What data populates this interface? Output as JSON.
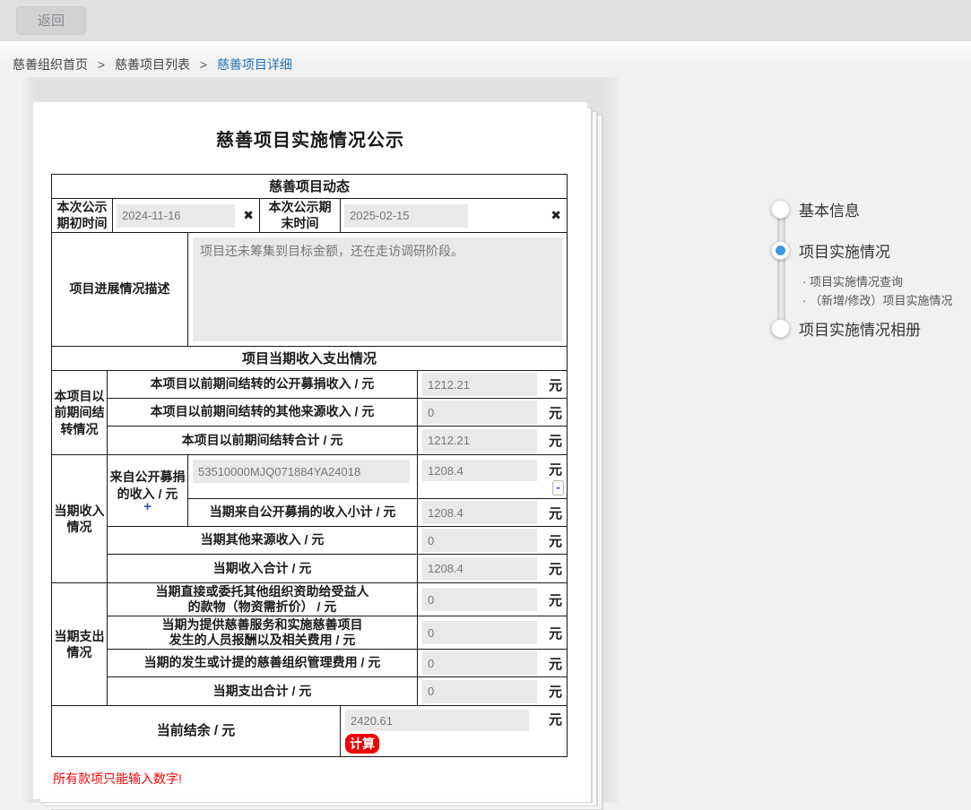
{
  "topbar": {
    "back_button": "返回"
  },
  "breadcrumb": {
    "separator": ">",
    "items": [
      "慈善组织首页",
      "慈善项目列表",
      "慈善项目详细"
    ]
  },
  "page": {
    "title": "慈善项目实施情况公示",
    "error_note": "所有款项只能输入数字!"
  },
  "dynamics": {
    "section_title": "慈善项目动态",
    "start_label": "本次公示期初时间",
    "start_value": "2024-11-16",
    "end_label": "本次公示期末时间",
    "end_value": "2025-02-15",
    "clear_icon": "✖",
    "desc_label": "项目进展情况描述",
    "desc_value": "项目还未筹集到目标金额，还在走访调研阶段。"
  },
  "finance": {
    "section_title": "项目当期收入支出情况",
    "unit": "元",
    "carryover": {
      "group_label": "本项目以前期间结转情况",
      "rows": [
        {
          "label": "本项目以前期间结转的公开募捐收入 / 元",
          "value": "1212.21"
        },
        {
          "label": "本项目以前期间结转的其他来源收入 / 元",
          "value": "0"
        },
        {
          "label": "本项目以前期间结转合计 / 元",
          "value": "1212.21"
        }
      ]
    },
    "income": {
      "group_label": "当期收入情况",
      "public_label": "来自公开募捐的收入 / 元",
      "add_icon": "+",
      "remove_icon": "-",
      "public_id": "53510000MJQ071884YA24018",
      "public_value": "1208.4",
      "subtotal_label": "当期来自公开募捐的收入小计 / 元",
      "subtotal_value": "1208.4",
      "rows": [
        {
          "label": "当期其他来源收入  / 元",
          "value": "0"
        },
        {
          "label": "当期收入合计 / 元",
          "value": "1208.4"
        }
      ]
    },
    "expense": {
      "group_label": "当期支出情况",
      "rows": [
        {
          "label": "当期直接或委托其他组织资助给受益人\n的款物（物资需折价） / 元",
          "value": "0"
        },
        {
          "label": "当期为提供慈善服务和实施慈善项目\n发生的人员报酬以及相关费用 / 元",
          "value": "0"
        },
        {
          "label": "当期的发生或计提的慈善组织管理费用 / 元",
          "value": "0"
        },
        {
          "label": "当期支出合计 / 元",
          "value": "0"
        }
      ]
    },
    "balance": {
      "label": "当前结余 / 元",
      "value": "2420.61",
      "calc_button": "计算"
    }
  },
  "stepper": {
    "steps": [
      {
        "label": "基本信息"
      },
      {
        "label": "项目实施情况"
      },
      {
        "label": "项目实施情况相册"
      }
    ],
    "subitems": [
      "· 项目实施情况查询",
      "· （新增/修改）项目实施情况"
    ]
  },
  "colors": {
    "accent_blue": "#3e97e0",
    "link_blue": "#2173b6",
    "error_red": "#ff0000",
    "calc_button_red": "#ee0000"
  }
}
